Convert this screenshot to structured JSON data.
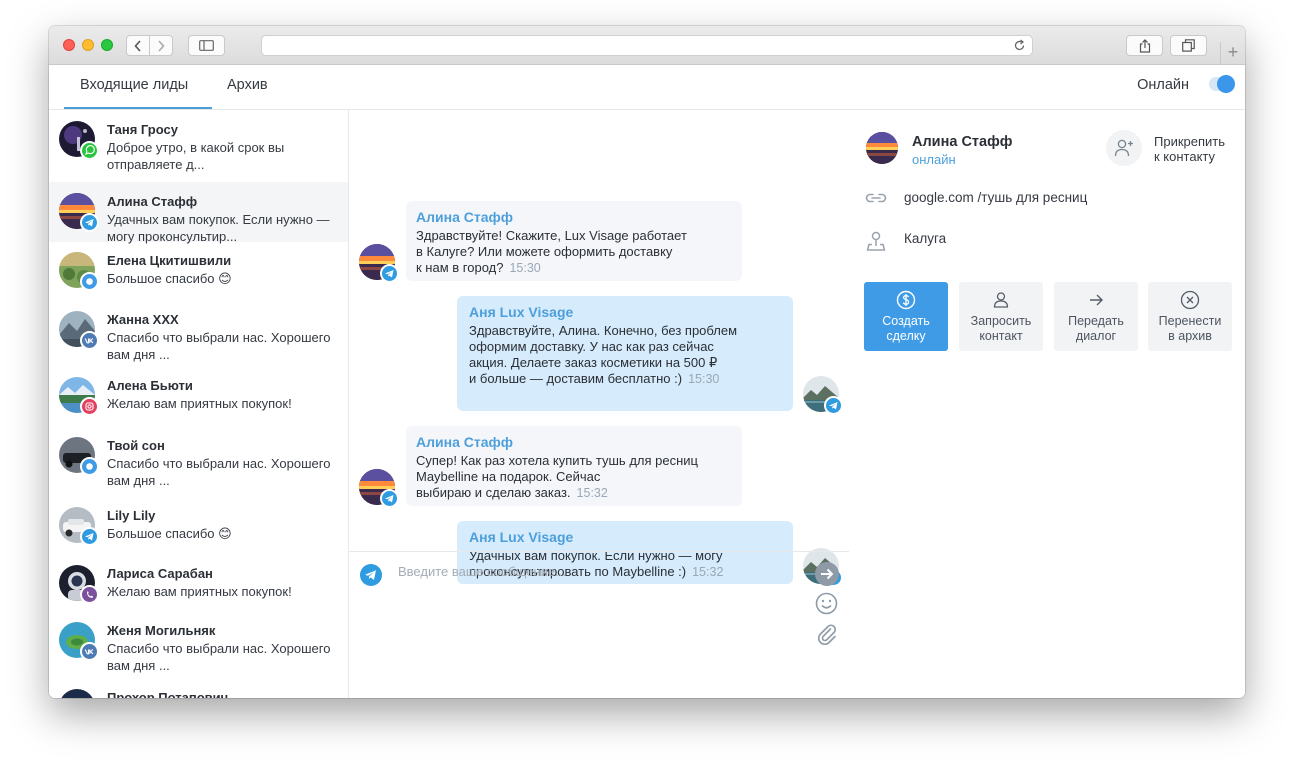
{
  "browser": {
    "address": ""
  },
  "nav": {
    "tabs": [
      {
        "label": "Входящие лиды",
        "active": true
      },
      {
        "label": "Архив",
        "active": false
      }
    ],
    "online_label": "Онлайн",
    "online_enabled": true
  },
  "contacts": [
    {
      "name": "Таня Гросу",
      "message": "Доброе утро, в какой срок вы отправляете д...",
      "channel": "whatsapp",
      "avatar": "violet-night"
    },
    {
      "name": "Алина Стафф",
      "message": "Удачных вам покупок. Если нужно — могу проконсультир...",
      "channel": "telegram",
      "avatar": "sunset",
      "selected": true
    },
    {
      "name": "Елена Цкитишвили",
      "message": "Большое спасибо 😊",
      "channel": "messenger",
      "avatar": "meadow"
    },
    {
      "name": "Жанна ХХХ",
      "message": "Спасибо что выбрали нас. Хорошего вам дня ...",
      "channel": "vk",
      "avatar": "grey-landscape"
    },
    {
      "name": "Алена Бьюти",
      "message": "Желаю вам приятных покупок!",
      "channel": "instagram",
      "avatar": "lake"
    },
    {
      "name": "Твой сон",
      "message": "Спасибо что выбрали нас. Хорошего вам дня ...",
      "channel": "messenger",
      "avatar": "car-dark"
    },
    {
      "name": "Lily Lily",
      "message": "Большое спасибо 😊",
      "channel": "telegram",
      "avatar": "car-white"
    },
    {
      "name": "Лариса Сарабан",
      "message": "Желаю вам приятных покупок!",
      "channel": "viber",
      "avatar": "astronaut"
    },
    {
      "name": "Женя Могильняк",
      "message": "Спасибо что выбрали нас. Хорошего вам дня ...",
      "channel": "vk",
      "avatar": "island"
    },
    {
      "name": "Прохор Потапович",
      "message": "",
      "channel": "",
      "avatar": "dark-blue"
    }
  ],
  "messages": [
    {
      "direction": "in",
      "author": "Алина Стафф",
      "lines": [
        "Здравствуйте! Скажите, Lux Visage работает",
        "в Калуге? Или можете оформить доставку",
        "к нам в город?"
      ],
      "time": "15:30"
    },
    {
      "direction": "out",
      "author": "Аня Lux Visage",
      "lines": [
        "Здравствуйте, Алина. Конечно, без проблем",
        "оформим доставку. У нас как раз сейчас",
        "акция. Делаете заказ косметики на 500 ₽",
        "и больше — доставим бесплатно :)"
      ],
      "time": "15:30"
    },
    {
      "direction": "in",
      "author": "Алина Стафф",
      "lines": [
        "Супер! Как раз хотела купить тушь для ресниц",
        "Maybelline на подарок. Сейчас",
        "выбираю и сделаю заказ."
      ],
      "time": "15:32"
    },
    {
      "direction": "out",
      "author": "Аня Lux Visage",
      "lines": [
        "Удачных вам покупок. Если нужно — могу",
        "проконсультировать по Maybelline  :)"
      ],
      "time": "15:32"
    }
  ],
  "composer": {
    "placeholder": "Введите ваше сообщение..."
  },
  "profile": {
    "name": "Алина Стафф",
    "status": "онлайн",
    "attach_label_1": "Прикрепить",
    "attach_label_2": "к контакту",
    "source": "google.com /тушь для ресниц",
    "city": "Калуга",
    "actions": [
      {
        "l1": "Создать",
        "l2": "сделку",
        "icon": "dollar-circle-icon"
      },
      {
        "l1": "Запросить",
        "l2": "контакт",
        "icon": "user-icon"
      },
      {
        "l1": "Передать",
        "l2": "диалог",
        "icon": "arrow-right-icon"
      },
      {
        "l1": "Перенести",
        "l2": "в архив",
        "icon": "x-circle-icon"
      }
    ]
  },
  "colors": {
    "accent": "#3f9be6",
    "link": "#4d9fdb",
    "bubble_in": "#f4f6fa",
    "bubble_out": "#d6ebfb",
    "telegram": "#2f9be0",
    "whatsapp": "#28c440",
    "vk": "#4f7bb5",
    "viber": "#7b519d",
    "instagram": "#e4405f",
    "messenger": "#3f9be6"
  }
}
